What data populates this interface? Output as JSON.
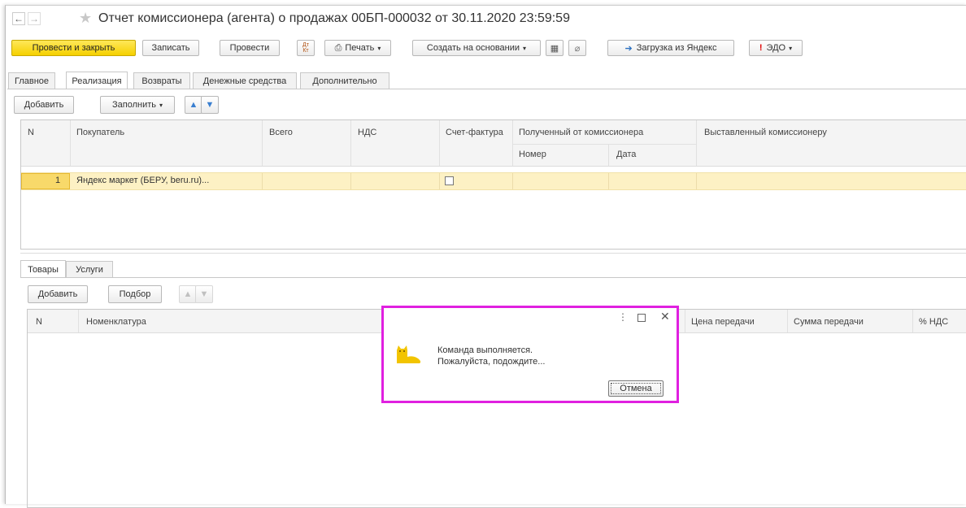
{
  "window": {
    "title": "Отчет комиссионера (агента) о продажах 00БП-000032 от 30.11.2020 23:59:59"
  },
  "toolbar": {
    "post_close": "Провести и закрыть",
    "save": "Записать",
    "post": "Провести",
    "dt_kt": "Дт Кт",
    "print": "Печать",
    "create_based": "Создать на основании",
    "load_yandex": "Загрузка из Яндекс",
    "edo": "ЭДО"
  },
  "tabs": [
    "Главное",
    "Реализация",
    "Возвраты",
    "Денежные средства",
    "Дополнительно"
  ],
  "top_panel": {
    "add": "Добавить",
    "fill": "Заполнить"
  },
  "top_table": {
    "headers": {
      "n": "N",
      "buyer": "Покупатель",
      "total": "Всего",
      "vat": "НДС",
      "invoice": "Счет-фактура",
      "received": "Полученный от комиссионера",
      "number": "Номер",
      "date": "Дата",
      "issued": "Выставленный комиссионеру"
    },
    "rows": [
      {
        "n": "1",
        "buyer": "Яндекс маркет (БЕРУ, beru.ru)...",
        "total": "",
        "vat": "",
        "invoice_checked": false
      }
    ]
  },
  "bottom_tabs": [
    "Товары",
    "Услуги"
  ],
  "bottom_panel": {
    "add": "Добавить",
    "select": "Подбор"
  },
  "bottom_table": {
    "headers": {
      "n": "N",
      "nomenclature": "Номенклатура",
      "price": "Цена передачи",
      "sum": "Сумма передачи",
      "vat_pct": "% НДС"
    }
  },
  "dialog": {
    "line1": "Команда выполняется.",
    "line2": "Пожалуйста, подождите...",
    "cancel": "Отмена",
    "border_color": "#e020e0"
  },
  "colors": {
    "selected_row": "#fdf1c4",
    "active_cell": "#f8d96a",
    "arrow_blue": "#3a7fd0"
  }
}
